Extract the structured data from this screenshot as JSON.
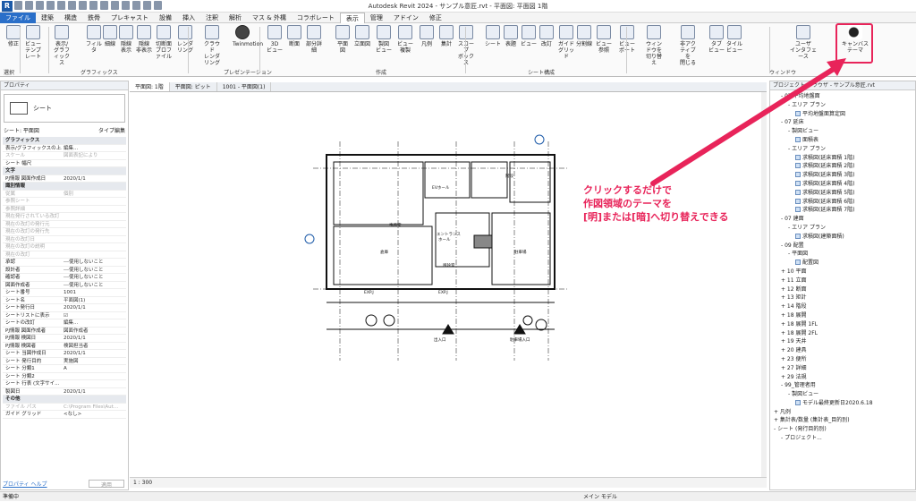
{
  "app": {
    "logo": "R",
    "title": "Autodesk Revit 2024 - サンプル意匠.rvt - 平面図: 平面図 1階"
  },
  "tabs": [
    "ファイル",
    "建築",
    "構造",
    "鉄骨",
    "プレキャスト",
    "設備",
    "挿入",
    "注釈",
    "解析",
    "マス & 外構",
    "コラボレート",
    "表示",
    "管理",
    "アドイン",
    "修正"
  ],
  "active_tab": "表示",
  "ribbon": {
    "buttons": [
      {
        "id": "modify",
        "label": "修正"
      },
      {
        "id": "view-template",
        "label": "ビュー\nテンプレート"
      },
      {
        "id": "visibility",
        "label": "表示/\nグラフィックス"
      },
      {
        "id": "filter",
        "label": "フィルタ"
      },
      {
        "id": "thin-line",
        "label": "細線"
      },
      {
        "id": "show-hidden",
        "label": "隠線\n表示"
      },
      {
        "id": "remove-hidden",
        "label": "隠線\n非表示"
      },
      {
        "id": "cut-profile",
        "label": "切断面\nプロファイル"
      },
      {
        "id": "render",
        "label": "レンダリング"
      },
      {
        "id": "cloud-render",
        "label": "クラウド\nレンダリング"
      },
      {
        "id": "twinmotion",
        "label": "Twinmotion"
      },
      {
        "id": "3d-view",
        "label": "3D\nビュー"
      },
      {
        "id": "section",
        "label": "断面"
      },
      {
        "id": "callout",
        "label": "部分詳細"
      },
      {
        "id": "plan-view",
        "label": "平面\n図"
      },
      {
        "id": "elevation",
        "label": "立面図"
      },
      {
        "id": "drafting",
        "label": "製図\nビュー"
      },
      {
        "id": "duplicate",
        "label": "ビュー\n複製"
      },
      {
        "id": "legend",
        "label": "凡例"
      },
      {
        "id": "schedule",
        "label": "集計"
      },
      {
        "id": "scope-box",
        "label": "スコープ\nボックス"
      },
      {
        "id": "sheet",
        "label": "シート"
      },
      {
        "id": "title-block",
        "label": "表題"
      },
      {
        "id": "view",
        "label": "ビュー"
      },
      {
        "id": "revision",
        "label": "改訂"
      },
      {
        "id": "guide-grid",
        "label": "ガイド\nグリッド"
      },
      {
        "id": "matchline",
        "label": "分割線"
      },
      {
        "id": "view-ref",
        "label": "ビュー\n参照"
      },
      {
        "id": "viewport",
        "label": "ビューポート"
      },
      {
        "id": "switch-window",
        "label": "ウィンドウを\n切り替え"
      },
      {
        "id": "close-inactive",
        "label": "非アクティブを\n閉じる"
      },
      {
        "id": "tab-views",
        "label": "タブ\nビュー"
      },
      {
        "id": "tile-views",
        "label": "タイル\nビュー"
      },
      {
        "id": "ui",
        "label": "ユーザ\nインタフェース"
      },
      {
        "id": "canvas-theme",
        "label": "キャンバス\nテーマ"
      }
    ],
    "groups": [
      "選択",
      "グラフィックス",
      "プレゼンテーション",
      "作成",
      "シート構成",
      "ウィンドウ"
    ]
  },
  "properties": {
    "title": "プロパティ",
    "type_name": "シート",
    "selector": "シート: 平面図",
    "edit_type": "タイプ編集",
    "rows": [
      {
        "k": "グラフィックス",
        "v": "",
        "g": true
      },
      {
        "k": "表示/グラフィックスの上...",
        "v": "編集..."
      },
      {
        "k": "スケール",
        "v": "図面表記により",
        "d": true
      },
      {
        "k": "シート 幅尺",
        "v": ""
      },
      {
        "k": "文字",
        "v": "",
        "g": true
      },
      {
        "k": "PJ情報 図面作成日",
        "v": "2020/1/1"
      },
      {
        "k": "識別情報",
        "v": "",
        "g": true
      },
      {
        "k": "従属",
        "v": "個別",
        "d": true
      },
      {
        "k": "参照シート",
        "v": "",
        "d": true
      },
      {
        "k": "参照詳細",
        "v": "",
        "d": true
      },
      {
        "k": "現在発行されている改訂",
        "v": "",
        "d": true
      },
      {
        "k": "現在の改訂の発行元",
        "v": "",
        "d": true
      },
      {
        "k": "現在の改訂の発行先",
        "v": "",
        "d": true
      },
      {
        "k": "現在の改訂日",
        "v": "",
        "d": true
      },
      {
        "k": "現在の改訂の説明",
        "v": "",
        "d": true
      },
      {
        "k": "現在の改訂",
        "v": "",
        "d": true
      },
      {
        "k": "承認",
        "v": "---使用しないこと"
      },
      {
        "k": "設計者",
        "v": "---使用しないこと"
      },
      {
        "k": "確認者",
        "v": "---使用しないこと"
      },
      {
        "k": "図面作成者",
        "v": "---使用しないこと"
      },
      {
        "k": "シート番号",
        "v": "1001"
      },
      {
        "k": "シート名",
        "v": "平面図(1)"
      },
      {
        "k": "シート発行日",
        "v": "2020/1/1"
      },
      {
        "k": "シートリストに表示",
        "v": "☑"
      },
      {
        "k": "シートの改訂",
        "v": "編集..."
      },
      {
        "k": "PJ情報 図面作成者",
        "v": "図面作成者"
      },
      {
        "k": "PJ情報 検図日",
        "v": "2020/1/1"
      },
      {
        "k": "PJ情報 検図者",
        "v": "検図担当者"
      },
      {
        "k": "シート 当図作成日",
        "v": "2020/1/1"
      },
      {
        "k": "シート 発行目的",
        "v": "実施図"
      },
      {
        "k": "シート 分類1",
        "v": "A"
      },
      {
        "k": "シート 分類2",
        "v": ""
      },
      {
        "k": "シート 行表 (文字サイ...",
        "v": ""
      },
      {
        "k": "製図日",
        "v": "2020/1/1"
      },
      {
        "k": "その他",
        "v": "",
        "g": true
      },
      {
        "k": "ファイル パス",
        "v": "C:\\Program Files\\Aut...",
        "d": true
      },
      {
        "k": "ガイド グリッド",
        "v": "<なし>"
      }
    ],
    "help": "プロパティ ヘルプ",
    "apply": "適用"
  },
  "view_tabs": [
    "平面図: 1階",
    "平面図: ピット",
    "1001 - 平面図(1)"
  ],
  "view_control": "1 : 300",
  "browser": {
    "title": "プロジェクト ブラウザ - サンプル意匠.rvt",
    "items": [
      {
        "t": "- 07 平均地盤面",
        "l": 1
      },
      {
        "t": "- エリア プラン",
        "l": 2
      },
      {
        "t": "平均地盤面算定図",
        "l": 3,
        "icon": true
      },
      {
        "t": "- 07 延床",
        "l": 1
      },
      {
        "t": "- 製図ビュー",
        "l": 2
      },
      {
        "t": "面積表",
        "l": 3,
        "icon": true
      },
      {
        "t": "- エリア プラン",
        "l": 2
      },
      {
        "t": "求積図(延床面積 1階)",
        "l": 3,
        "icon": true
      },
      {
        "t": "求積図(延床面積 2階)",
        "l": 3,
        "icon": true
      },
      {
        "t": "求積図(延床面積 3階)",
        "l": 3,
        "icon": true
      },
      {
        "t": "求積図(延床面積 4階)",
        "l": 3,
        "icon": true
      },
      {
        "t": "求積図(延床面積 5階)",
        "l": 3,
        "icon": true
      },
      {
        "t": "求積図(延床面積 6階)",
        "l": 3,
        "icon": true
      },
      {
        "t": "求積図(延床面積 7階)",
        "l": 3,
        "icon": true
      },
      {
        "t": "- 07 建面",
        "l": 1
      },
      {
        "t": "- エリア プラン",
        "l": 2
      },
      {
        "t": "求積図(建築面積)",
        "l": 3,
        "icon": true
      },
      {
        "t": "- 09 配置",
        "l": 1
      },
      {
        "t": "- 平面図",
        "l": 2
      },
      {
        "t": "配置図",
        "l": 3,
        "icon": true
      },
      {
        "t": "+ 10 平面",
        "l": 1
      },
      {
        "t": "+ 11 立面",
        "l": 1
      },
      {
        "t": "+ 12 断面",
        "l": 1
      },
      {
        "t": "+ 13 矩計",
        "l": 1
      },
      {
        "t": "+ 14 階段",
        "l": 1
      },
      {
        "t": "+ 18 展開",
        "l": 1
      },
      {
        "t": "+ 18 展開 1FL",
        "l": 1
      },
      {
        "t": "+ 18 展開 2FL",
        "l": 1
      },
      {
        "t": "+ 19 天井",
        "l": 1
      },
      {
        "t": "+ 20 建具",
        "l": 1
      },
      {
        "t": "+ 23 便所",
        "l": 1
      },
      {
        "t": "+ 27 詳細",
        "l": 1
      },
      {
        "t": "+ 29 法規",
        "l": 1
      },
      {
        "t": "- 99_管理者用",
        "l": 1
      },
      {
        "t": "- 製図ビュー",
        "l": 2
      },
      {
        "t": "モデル最終更新日2020.6.18",
        "l": 3,
        "icon": true
      },
      {
        "t": "+ 凡例",
        "l": 0
      },
      {
        "t": "+ 集計表/数量 (集計表_目的別)",
        "l": 0
      },
      {
        "t": "- シート (発行目的別)",
        "l": 0
      },
      {
        "t": "- プロジェクト...",
        "l": 1
      }
    ]
  },
  "status": {
    "left": "準備中",
    "model": "メイン モデル"
  },
  "annotation": "クリックするだけで\n作図領域のテーマを\n[明]または[暗]へ切り替えできる",
  "plan_labels": [
    "エントランス\nホール",
    "風除室",
    "倉庫",
    "駐車場",
    "階段",
    "EV",
    "EVホール",
    "事務室",
    "EXP.J",
    "EXP.J",
    "出入口",
    "駐車場入口"
  ],
  "colors": {
    "accent": "#e8245a",
    "file_tab": "#2a6fc9"
  }
}
